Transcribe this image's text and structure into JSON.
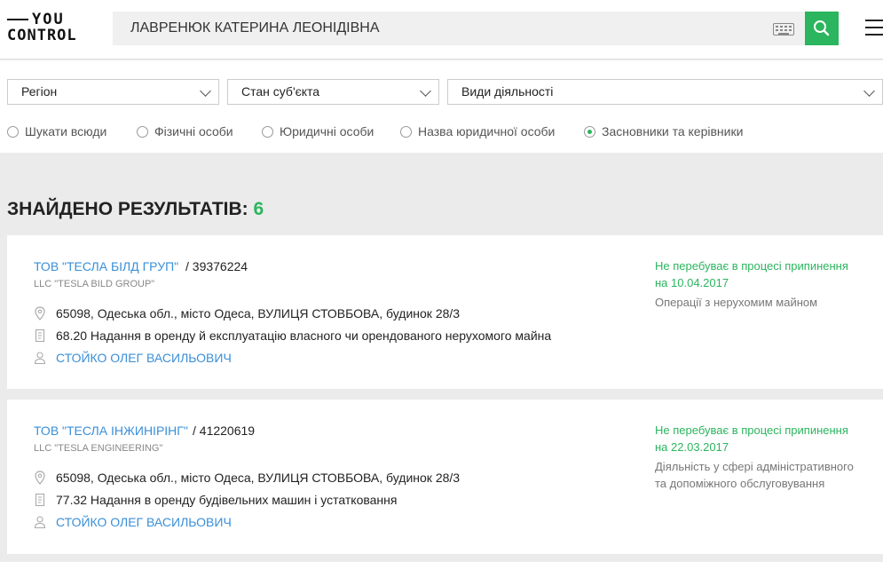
{
  "header": {
    "logo_line1": "YOU",
    "logo_line2": "CONTROL",
    "search_value": "ЛАВРЕНЮК КАТЕРИНА ЛЕОНІДІВНА"
  },
  "filters": {
    "region": "Регіон",
    "state": "Стан суб'єкта",
    "activity": "Види діяльності",
    "radios": [
      {
        "label": "Шукати всюди",
        "selected": false
      },
      {
        "label": "Фізичні особи",
        "selected": false
      },
      {
        "label": "Юридичні особи",
        "selected": false
      },
      {
        "label": "Назва юридичної особи",
        "selected": false
      },
      {
        "label": "Засновники та керівники",
        "selected": true
      }
    ]
  },
  "results": {
    "label": "ЗНАЙДЕНО РЕЗУЛЬТАТІВ:",
    "count": "6",
    "items": [
      {
        "name": "ТОВ \"ТЕСЛА БІЛД ГРУП\"",
        "code": "/ 39376224",
        "latin": "LLC \"TESLA BILD GROUP\"",
        "address": "65098, Одеська обл., місто Одеса, ВУЛИЦЯ СТОВБОВА, будинок 28/3",
        "kved": "68.20 Надання в оренду й експлуатацію власного чи орендованого нерухомого майна",
        "person": "СТОЙКО ОЛЕГ ВАСИЛЬОВИЧ",
        "status_line1": "Не перебуває в процесі припинення",
        "status_line2": "на 10.04.2017",
        "activity_line1": "Операції з нерухомим майном",
        "activity_line2": ""
      },
      {
        "name": "ТОВ \"ТЕСЛА ІНЖИНІРІНГ\"",
        "code": "/ 41220619",
        "latin": "LLC \"TESLA ENGINEERING\"",
        "address": "65098, Одеська обл., місто Одеса, ВУЛИЦЯ СТОВБОВА, будинок 28/3",
        "kved": "77.32 Надання в оренду будівельних машин і устатковання",
        "person": "СТОЙКО ОЛЕГ ВАСИЛЬОВИЧ",
        "status_line1": "Не перебуває в процесі припинення",
        "status_line2": "на 22.03.2017",
        "activity_line1": "Діяльність у сфері адміністративного",
        "activity_line2": "та допоміжного обслуговування"
      }
    ]
  },
  "colors": {
    "accent": "#2bb55e",
    "link": "#3a8fd8"
  }
}
